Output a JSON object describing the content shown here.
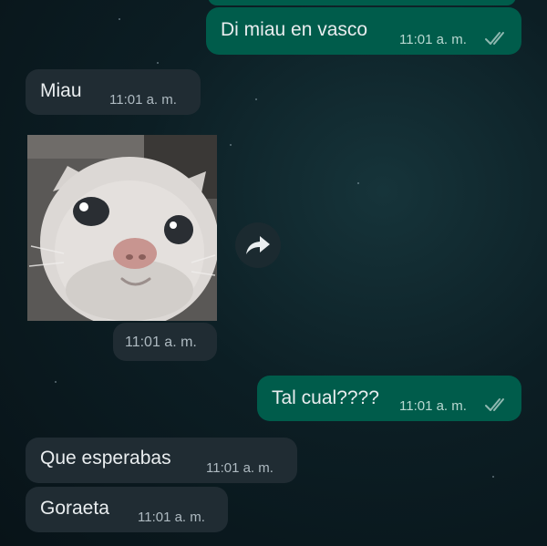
{
  "messages": [
    {
      "direction": "outgoing",
      "text": "Di miau en vasco",
      "time": "11:01 a. m.",
      "status": "read"
    },
    {
      "direction": "incoming",
      "text": "Miau",
      "time": "11:01 a. m."
    },
    {
      "direction": "incoming",
      "type": "image",
      "alt": "cat photo",
      "time": "11:01 a. m."
    },
    {
      "direction": "outgoing",
      "text": "Tal cual????",
      "time": "11:01 a. m.",
      "status": "read"
    },
    {
      "direction": "incoming",
      "text": "Que esperabas",
      "time": "11:01 a. m."
    },
    {
      "direction": "incoming",
      "text": "Goraeta",
      "time": "11:01 a. m."
    }
  ],
  "colors": {
    "outgoing_bubble": "#005c4b",
    "incoming_bubble": "#202c33",
    "text": "#e9edef",
    "timestamp": "#aebac1",
    "read_ticks": "#8fb8b0",
    "background": "#0c1e24"
  },
  "icons": {
    "forward": "forward-arrow-icon",
    "read_receipt": "double-check-icon"
  }
}
